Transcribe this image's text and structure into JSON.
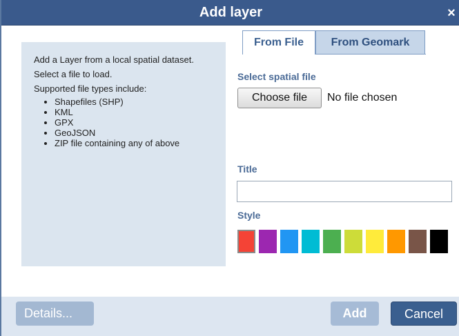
{
  "dialog": {
    "title": "Add layer",
    "close_glyph": "×"
  },
  "info": {
    "lines": [
      "Add a Layer from a local spatial dataset.",
      "Select a file to load.",
      "Supported file types include:"
    ],
    "file_types": [
      "Shapefiles (SHP)",
      "KML",
      "GPX",
      "GeoJSON",
      "ZIP file containing any of above"
    ]
  },
  "tabs": [
    {
      "label": "From File",
      "active": true
    },
    {
      "label": "From Geomark",
      "active": false
    }
  ],
  "file_section": {
    "label": "Select spatial file",
    "button_label": "Choose file",
    "status": "No file chosen"
  },
  "title_section": {
    "label": "Title",
    "value": "",
    "placeholder": ""
  },
  "style_section": {
    "label": "Style",
    "selected_index": 0,
    "colors": [
      {
        "name": "red",
        "hex": "#f44336"
      },
      {
        "name": "purple",
        "hex": "#9c27b0"
      },
      {
        "name": "blue",
        "hex": "#2196f3"
      },
      {
        "name": "cyan",
        "hex": "#00bcd4"
      },
      {
        "name": "green",
        "hex": "#4caf50"
      },
      {
        "name": "lime",
        "hex": "#cddc39"
      },
      {
        "name": "yellow",
        "hex": "#ffeb3b"
      },
      {
        "name": "orange",
        "hex": "#ff9800"
      },
      {
        "name": "brown",
        "hex": "#795548"
      },
      {
        "name": "black",
        "hex": "#000000"
      }
    ]
  },
  "footer": {
    "details_label": "Details...",
    "add_label": "Add",
    "cancel_label": "Cancel"
  },
  "theme": {
    "header_bg": "#3a5a8c",
    "accent": "#4a6a96",
    "panel_bg": "#dbe5ef"
  }
}
